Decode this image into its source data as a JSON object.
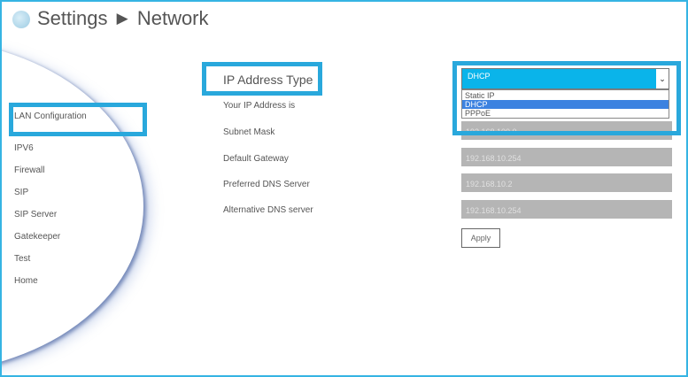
{
  "header": {
    "title": "Settings",
    "separator": "▶",
    "subtitle": "Network"
  },
  "sidebar": {
    "items": [
      {
        "label": "LAN Configuration"
      },
      {
        "label": "IPV6"
      },
      {
        "label": "Firewall"
      },
      {
        "label": "SIP"
      },
      {
        "label": "SIP Server"
      },
      {
        "label": "Gatekeeper"
      },
      {
        "label": "Test"
      },
      {
        "label": "Home"
      }
    ]
  },
  "form": {
    "ip_type_label": "IP Address Type",
    "ip_address_label": "Your IP Address is",
    "subnet_mask_label": "Subnet Mask",
    "gateway_label": "Default Gateway",
    "preferred_dns_label": "Preferred DNS Server",
    "alternative_dns_label": "Alternative DNS server",
    "subnet_mask_value": "192.168.100.0",
    "gateway_value": "192.168.10.254",
    "preferred_dns_value": "192.168.10.2",
    "alternative_dns_value": "192.168.10.254",
    "apply_label": "Apply"
  },
  "ip_type_select": {
    "selected": "DHCP",
    "arrow": "⌄",
    "options": [
      "Static IP",
      "DHCP",
      "PPPoE"
    ]
  },
  "colors": {
    "accent": "#29a8dc",
    "select_bg": "#0ab4ea",
    "option_highlight": "#3c82e0",
    "field_bg": "#b5b5b5"
  }
}
